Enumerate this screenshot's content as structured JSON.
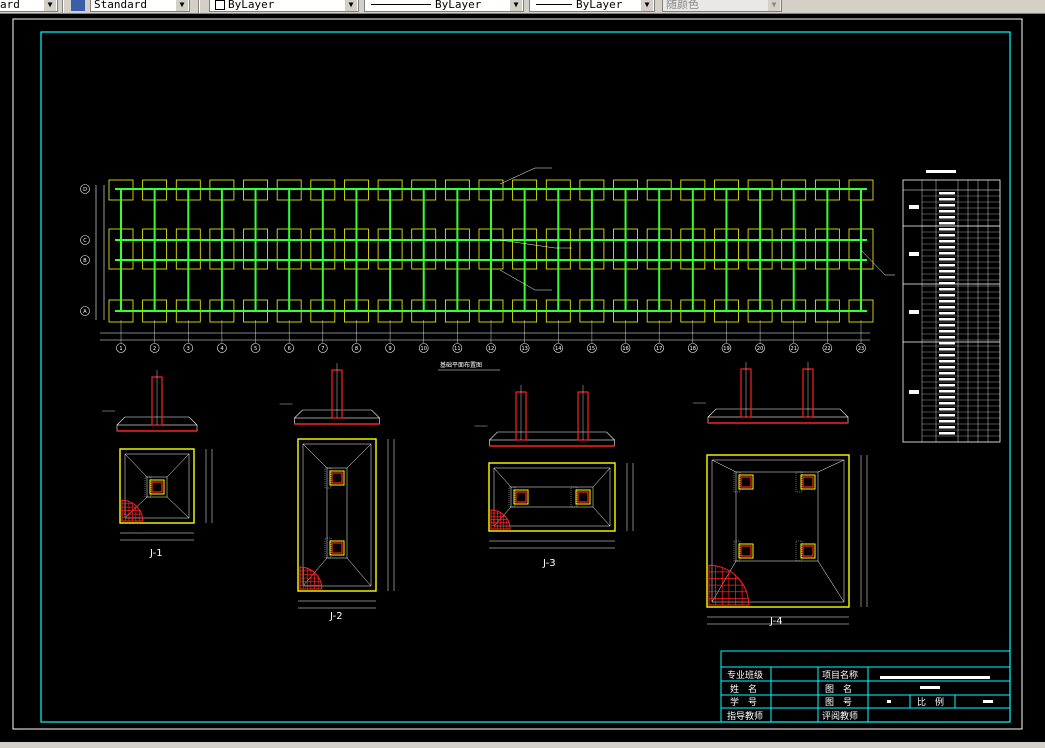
{
  "toolbar": {
    "textstyle": "ard",
    "dimstyle": "Standard",
    "color": "ByLayer",
    "linetype": "ByLayer",
    "lineweight": "ByLayer",
    "plotstyle": "随颜色"
  },
  "plan": {
    "row_labels": [
      "D",
      "C",
      "B",
      "A"
    ],
    "col_count": 23,
    "col_labels": [
      "1",
      "2",
      "3",
      "4",
      "5",
      "6",
      "7",
      "8",
      "9",
      "10",
      "11",
      "12",
      "13",
      "14",
      "15",
      "16",
      "17",
      "18",
      "19",
      "20",
      "21",
      "22",
      "23"
    ],
    "title": "基础平面布置图"
  },
  "details": [
    {
      "label": "J-1"
    },
    {
      "label": "J-2"
    },
    {
      "label": "J-3"
    },
    {
      "label": "J-4"
    }
  ],
  "titleblock": {
    "r1": [
      "专业班级",
      "",
      "项目名称",
      ""
    ],
    "r2": [
      "姓　名",
      "",
      "图　名",
      ""
    ],
    "r3": [
      "学　号",
      "",
      "图　号",
      "",
      "比　例",
      ""
    ],
    "r4": [
      "指导教师",
      "",
      "评阅教师",
      ""
    ]
  },
  "colors": {
    "frame": "#00ffff",
    "column_lines": "#33ff33",
    "footing": "#ffff00",
    "rebar": "#ff2020",
    "text": "#ffffff"
  }
}
